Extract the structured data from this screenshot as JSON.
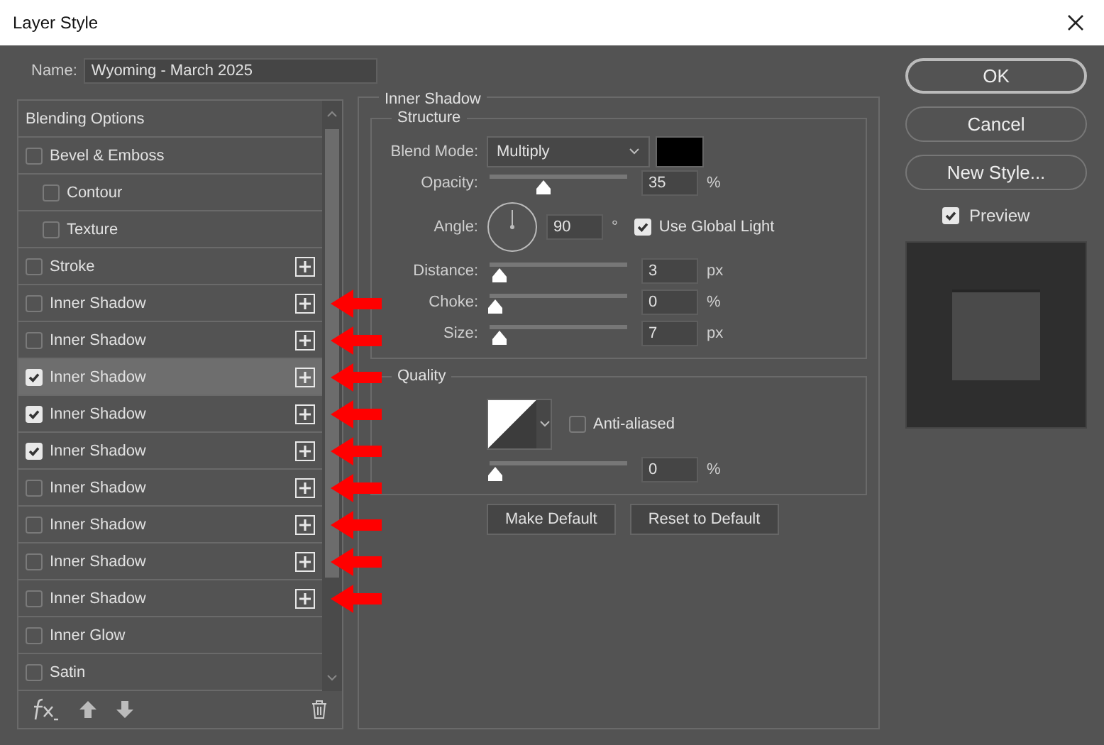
{
  "window": {
    "title": "Layer Style"
  },
  "name_field": {
    "label": "Name:",
    "value": "Wyoming - March 2025"
  },
  "styles": [
    {
      "kind": "header",
      "label": "Blending Options",
      "add": false,
      "selected": false,
      "arrow": false
    },
    {
      "kind": "item",
      "label": "Bevel & Emboss",
      "checked": false,
      "add": false,
      "selected": false,
      "arrow": false
    },
    {
      "kind": "sub",
      "label": "Contour",
      "checked": false,
      "add": false,
      "selected": false,
      "arrow": false
    },
    {
      "kind": "sub",
      "label": "Texture",
      "checked": false,
      "add": false,
      "selected": false,
      "arrow": false
    },
    {
      "kind": "item",
      "label": "Stroke",
      "checked": false,
      "add": true,
      "selected": false,
      "arrow": false
    },
    {
      "kind": "item",
      "label": "Inner Shadow",
      "checked": false,
      "add": true,
      "selected": false,
      "arrow": true
    },
    {
      "kind": "item",
      "label": "Inner Shadow",
      "checked": false,
      "add": true,
      "selected": false,
      "arrow": true
    },
    {
      "kind": "item",
      "label": "Inner Shadow",
      "checked": true,
      "add": true,
      "selected": true,
      "arrow": true
    },
    {
      "kind": "item",
      "label": "Inner Shadow",
      "checked": true,
      "add": true,
      "selected": false,
      "arrow": true
    },
    {
      "kind": "item",
      "label": "Inner Shadow",
      "checked": true,
      "add": true,
      "selected": false,
      "arrow": true
    },
    {
      "kind": "item",
      "label": "Inner Shadow",
      "checked": false,
      "add": true,
      "selected": false,
      "arrow": true
    },
    {
      "kind": "item",
      "label": "Inner Shadow",
      "checked": false,
      "add": true,
      "selected": false,
      "arrow": true
    },
    {
      "kind": "item",
      "label": "Inner Shadow",
      "checked": false,
      "add": true,
      "selected": false,
      "arrow": true
    },
    {
      "kind": "item",
      "label": "Inner Shadow",
      "checked": false,
      "add": true,
      "selected": false,
      "arrow": true
    },
    {
      "kind": "item",
      "label": "Inner Glow",
      "checked": false,
      "add": false,
      "selected": false,
      "arrow": false
    },
    {
      "kind": "item",
      "label": "Satin",
      "checked": false,
      "add": false,
      "selected": false,
      "arrow": false
    }
  ],
  "panel": {
    "title": "Inner Shadow",
    "structure": {
      "title": "Structure",
      "rows": [
        {
          "kind": "select",
          "label": "Blend Mode:",
          "value": "Multiply"
        },
        {
          "kind": "slider",
          "label": "Opacity:",
          "level": 0.35,
          "value": "35",
          "unit": "%"
        },
        {
          "kind": "angle",
          "label": "Angle:",
          "value": "90",
          "unit": "°",
          "check_label": "Use Global Light",
          "checked": true
        },
        {
          "kind": "slider",
          "label": "Distance:",
          "level": 0.03,
          "value": "3",
          "unit": "px"
        },
        {
          "kind": "slider",
          "label": "Choke:",
          "level": 0,
          "value": "0",
          "unit": "%"
        },
        {
          "kind": "slider",
          "label": "Size:",
          "level": 0.03,
          "value": "7",
          "unit": "px"
        }
      ]
    },
    "quality": {
      "title": "Quality",
      "contour": {
        "check_label": "Anti-aliased",
        "checked": false
      },
      "noise": {
        "level": 0,
        "value": "0",
        "unit": "%"
      }
    },
    "buttons": [
      "Make Default",
      "Reset to Default"
    ]
  },
  "actions": [
    {
      "label": "OK",
      "default": true
    },
    {
      "label": "Cancel",
      "default": false
    },
    {
      "label": "New Style...",
      "default": false
    }
  ],
  "preview": {
    "label": "Preview",
    "checked": true
  }
}
